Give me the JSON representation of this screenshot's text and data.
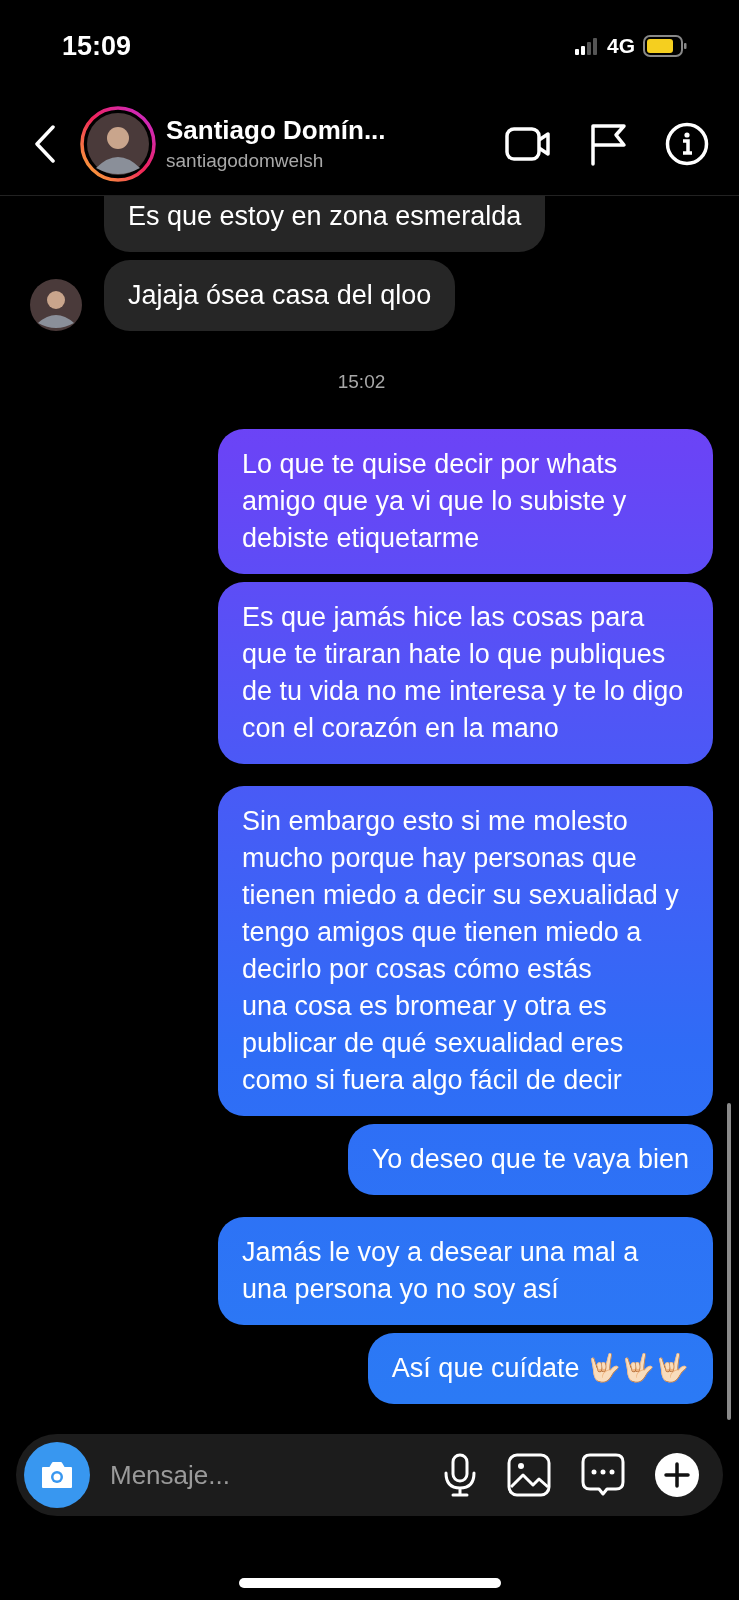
{
  "status_bar": {
    "time": "15:09",
    "network": "4G"
  },
  "header": {
    "name": "Santiago Domín...",
    "username": "santiagodomwelsh"
  },
  "conversation": [
    {
      "kind": "received",
      "messages": [
        "Es que estoy en zona esmeralda",
        "Jajaja ósea casa del qloo"
      ]
    },
    {
      "kind": "timestamp",
      "text": "15:02"
    },
    {
      "kind": "sent",
      "messages": [
        "Lo que te quise decir por whats amigo que ya vi que lo subiste y debiste etiquetarme",
        "Es que jamás hice las cosas para que te tiraran hate lo que publiques de tu vida no me interesa y te lo digo con el corazón en la mano"
      ]
    },
    {
      "kind": "sent",
      "messages": [
        "Sin embargo esto si me molesto mucho porque hay personas que tienen miedo a decir su sexualidad y tengo amigos que tienen miedo a decirlo por cosas cómo estás\nuna cosa es bromear y otra es publicar de qué sexualidad eres como si fuera algo fácil de decir",
        "Yo deseo que te vaya bien"
      ]
    },
    {
      "kind": "sent",
      "messages": [
        "Jamás le voy a desear una mal a una persona yo no soy así",
        "Así que cuídate 🤟🏻🤟🏻🤟🏻"
      ]
    }
  ],
  "composer": {
    "placeholder": "Mensaje..."
  }
}
